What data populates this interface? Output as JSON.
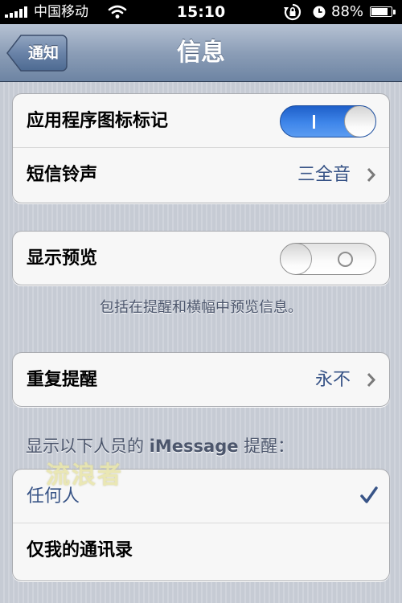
{
  "status_bar": {
    "carrier": "中国移动",
    "time": "15:10",
    "battery_percent": "88%",
    "battery_level": 0.88,
    "icons": [
      "signal-bars-icon",
      "wifi-icon",
      "rotation-lock-icon",
      "alarm-icon",
      "battery-icon"
    ]
  },
  "nav": {
    "back_label": "通知",
    "title": "信息"
  },
  "group1": {
    "badge_label": "应用程序图标标记",
    "badge_switch_on": true,
    "ringtone_label": "短信铃声",
    "ringtone_value": "三全音"
  },
  "group2": {
    "preview_label": "显示预览",
    "preview_switch_on": false,
    "footer": "包括在提醒和横幅中预览信息。"
  },
  "group3": {
    "repeat_label": "重复提醒",
    "repeat_value": "永不"
  },
  "imessage_section": {
    "header_prefix": "显示以下人员的",
    "header_bold": "iMessage",
    "header_suffix": "提醒：",
    "options": [
      {
        "label": "任何人",
        "selected": true
      },
      {
        "label": "仅我的通讯录",
        "selected": false
      }
    ]
  },
  "watermark": "流浪者",
  "colors": {
    "accent_blue": "#385487",
    "switch_on": "#3f86ea",
    "nav_bar": "#8c9eb7"
  }
}
